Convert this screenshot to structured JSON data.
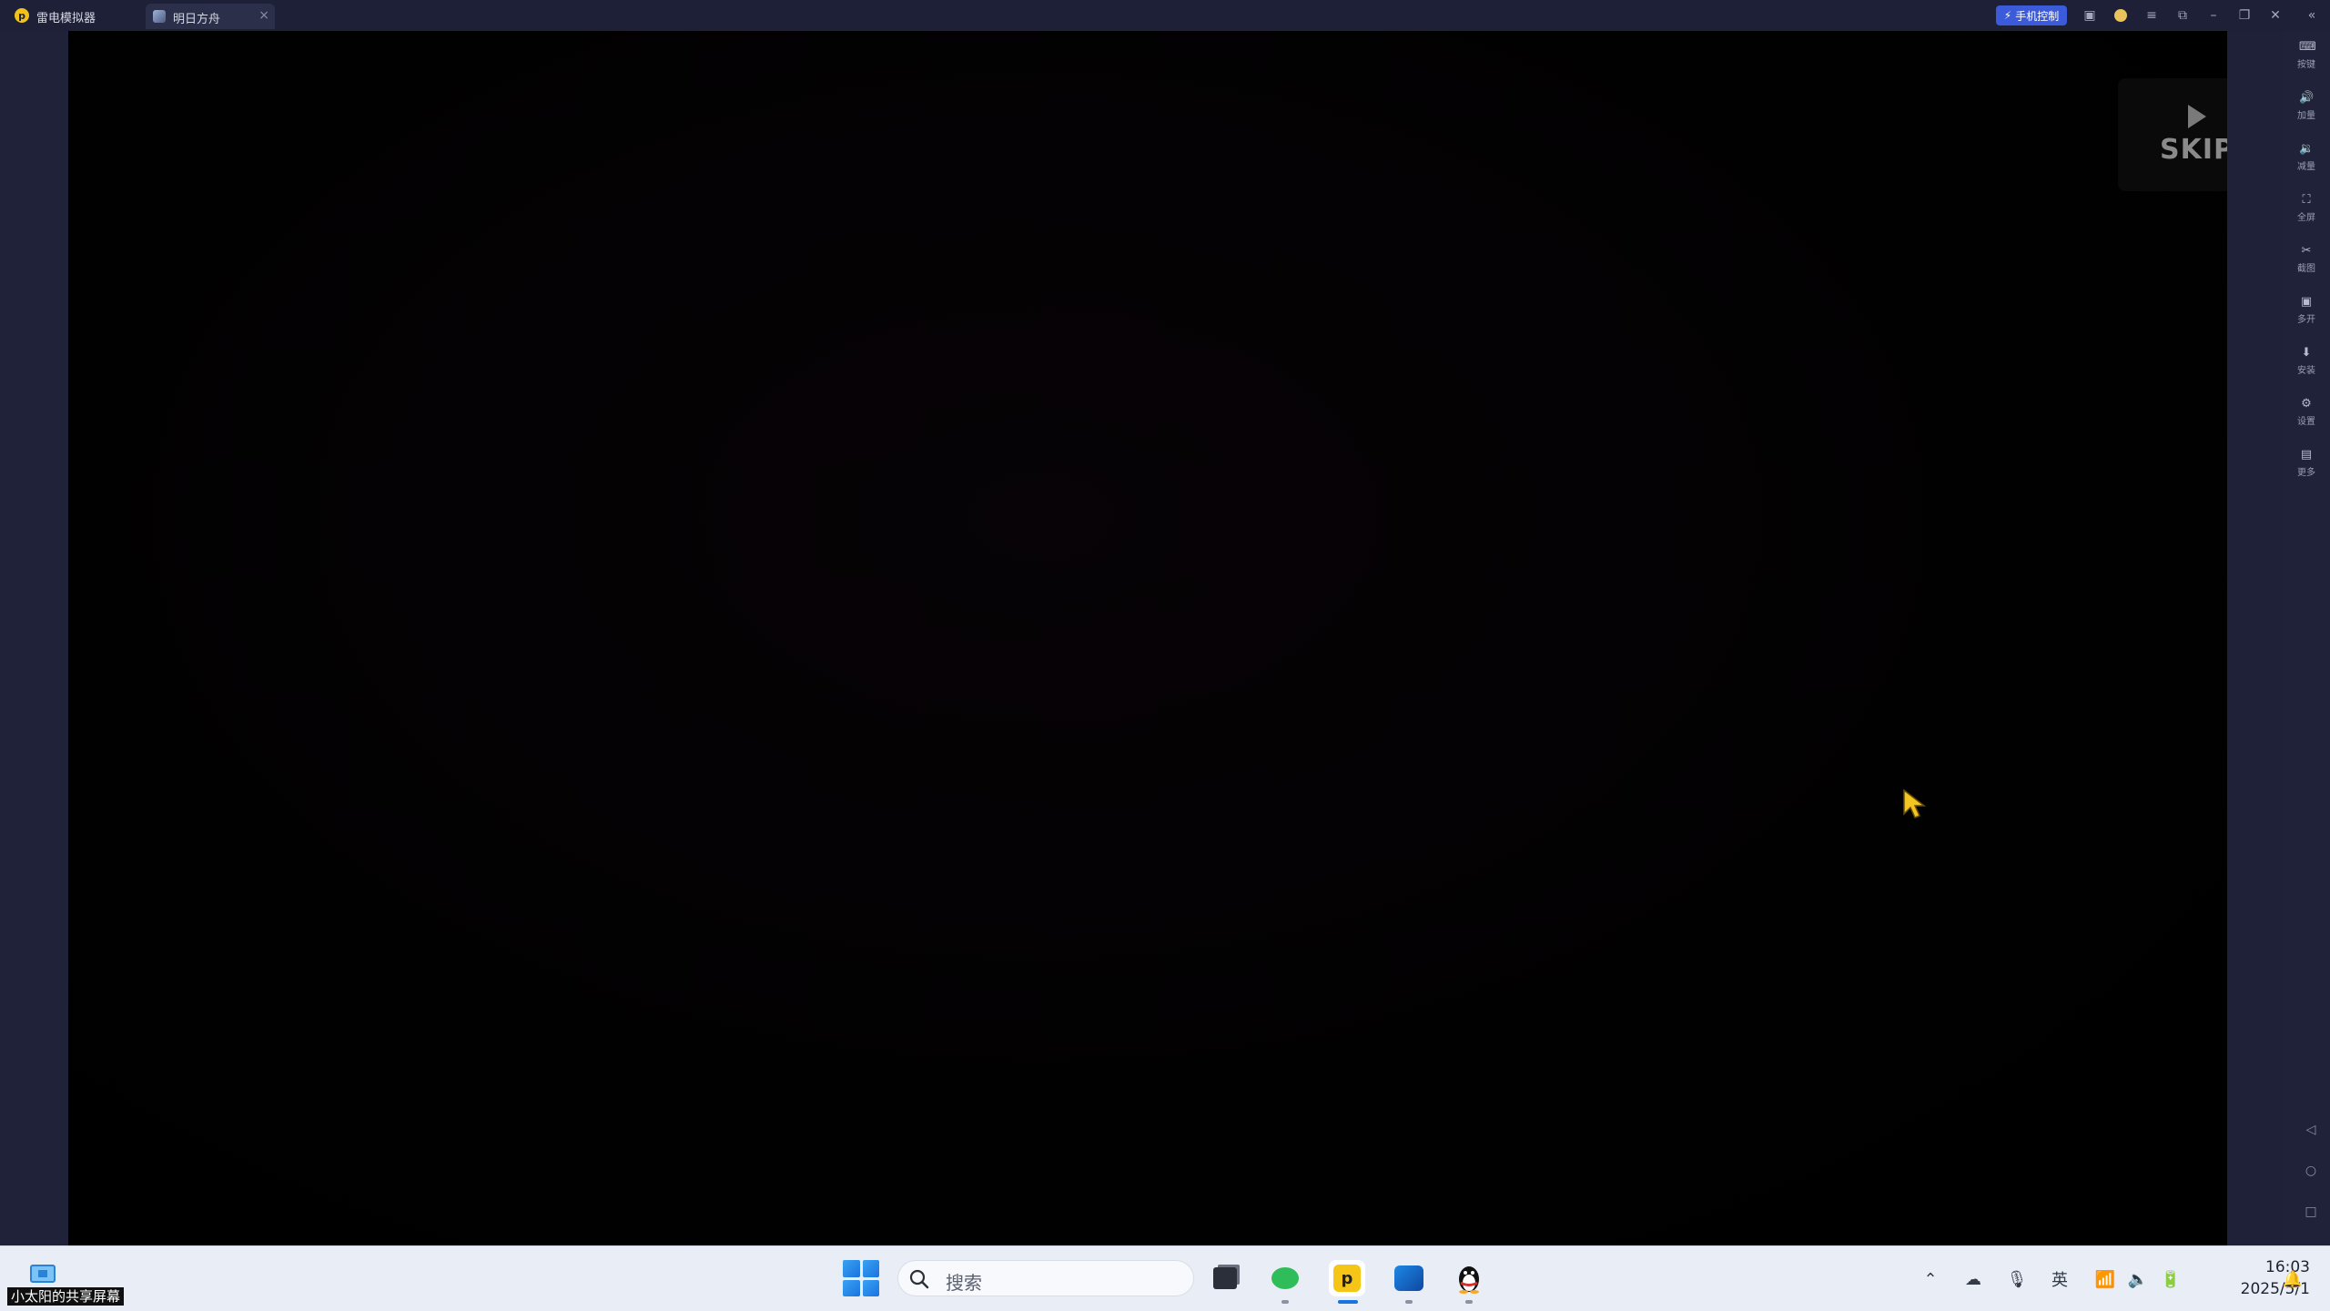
{
  "window": {
    "app_name": "雷电模拟器",
    "tab_label": "明日方舟",
    "tab_close": "×",
    "mobile_control_label": "手机控制"
  },
  "game": {
    "skip_label": "SKIP"
  },
  "right_sidebar": {
    "items": [
      {
        "label": "按键",
        "icon": "keyboard-icon"
      },
      {
        "label": "加量",
        "icon": "volume-up-icon"
      },
      {
        "label": "减量",
        "icon": "volume-down-icon"
      },
      {
        "label": "全屏",
        "icon": "fullscreen-icon"
      },
      {
        "label": "截图",
        "icon": "scissors-icon"
      },
      {
        "label": "多开",
        "icon": "multi-instance-icon"
      },
      {
        "label": "安装",
        "icon": "install-icon"
      },
      {
        "label": "设置",
        "icon": "gear-icon"
      },
      {
        "label": "更多",
        "icon": "more-icon"
      }
    ]
  },
  "taskbar": {
    "share_label": "小太阳的共享屏幕",
    "search_placeholder": "搜索",
    "ime_label": "英",
    "time": "16:03",
    "date": "2025/5/1"
  },
  "colors": {
    "chrome_bg": "#1d2036",
    "accent": "#3b5bdb",
    "taskbar_bg": "#e9eef6"
  }
}
